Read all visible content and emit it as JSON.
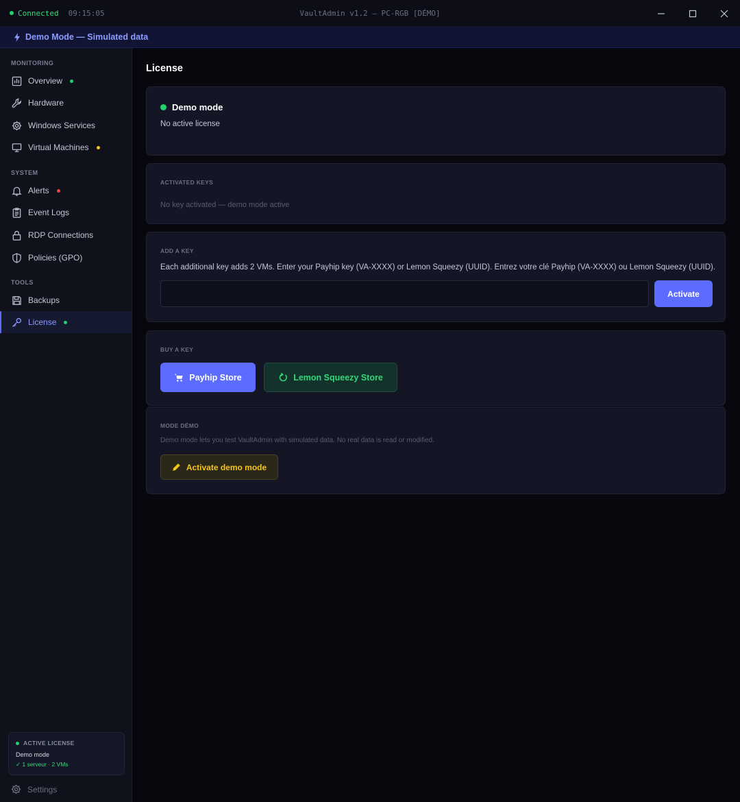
{
  "titlebar": {
    "status": "Connected",
    "time": "09:15:05",
    "title": "VaultAdmin v1.2 — PC-RGB [DÉMO]",
    "colors": {
      "connected": "#22d36b"
    }
  },
  "banner": {
    "text": "Demo Mode — Simulated data",
    "icon": "bolt-icon"
  },
  "sidebar": {
    "sections": {
      "monitoring": "MONITORING",
      "system": "SYSTEM",
      "tools": "TOOLS"
    },
    "items": {
      "overview": {
        "label": "Overview",
        "icon": "chart-icon",
        "dot": "#22d36b"
      },
      "hardware": {
        "label": "Hardware",
        "icon": "wrench-icon"
      },
      "services": {
        "label": "Windows Services",
        "icon": "gear-icon"
      },
      "vms": {
        "label": "Virtual Machines",
        "icon": "monitor-icon",
        "dot": "#f5c518"
      },
      "alerts": {
        "label": "Alerts",
        "icon": "bell-icon",
        "dot": "#ef4444"
      },
      "eventlogs": {
        "label": "Event Logs",
        "icon": "clipboard-icon"
      },
      "rdp": {
        "label": "RDP Connections",
        "icon": "lock-icon"
      },
      "policies": {
        "label": "Policies (GPO)",
        "icon": "shield-icon"
      },
      "backups": {
        "label": "Backups",
        "icon": "floppy-icon"
      },
      "license": {
        "label": "License",
        "icon": "key-icon",
        "dot": "#22d36b",
        "active": true
      }
    },
    "license_box": {
      "heading": "ACTIVE LICENSE",
      "mode": "Demo mode",
      "capacity": "✓ 1 serveur · 2 VMs"
    },
    "settings": {
      "label": "Settings",
      "icon": "gear-icon"
    }
  },
  "main": {
    "title": "License",
    "status_card": {
      "title": "Demo mode",
      "subtitle": "No active license"
    },
    "activated_keys": {
      "label": "ACTIVATED KEYS",
      "empty_text": "No key activated — demo mode active"
    },
    "add_key": {
      "label": "ADD A KEY",
      "description": "Each additional key adds 2 VMs. Enter your Payhip key (VA-XXXX) or Lemon Squeezy (UUID). Entrez votre clé Payhip (VA-XXXX) ou Lemon Squeezy (UUID).",
      "input_value": "",
      "activate_label": "Activate"
    },
    "buy_key": {
      "label": "BUY A KEY",
      "payhip_label": "Payhip Store",
      "payhip_icon": "cart-icon",
      "lemon_label": "Lemon Squeezy Store",
      "lemon_icon": "lemon-icon"
    },
    "demo_card": {
      "label": "MODE DÉMO",
      "description": "Demo mode lets you test VaultAdmin with simulated data. No real data is read or modified.",
      "button_label": "Activate demo mode",
      "button_icon": "pencil-icon"
    },
    "colors": {
      "accent": "#5b6cff",
      "success": "#22d36b",
      "warning": "#f5c518",
      "danger": "#ef4444"
    }
  }
}
